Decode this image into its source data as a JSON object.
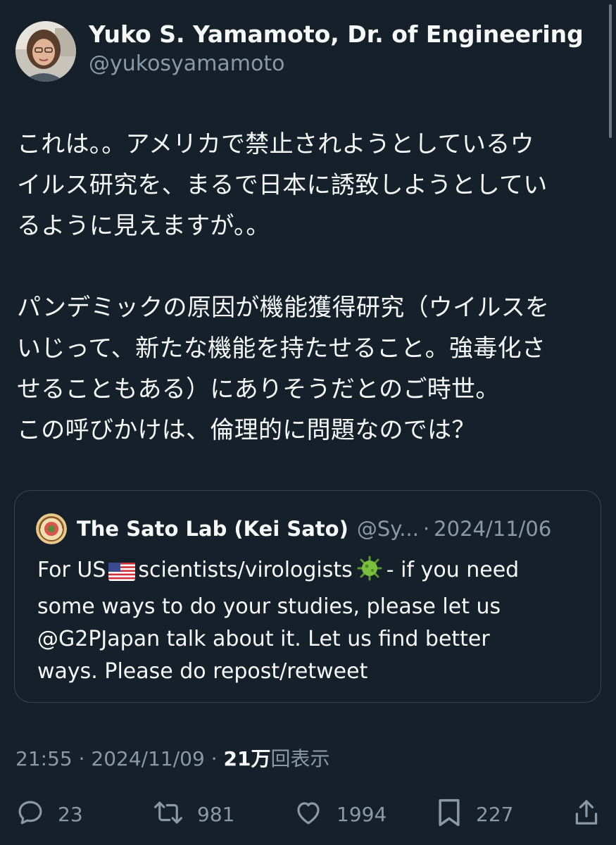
{
  "author": {
    "name": "Yuko S. Yamamoto, Dr. of Engineering",
    "handle": "@yukosyamamoto"
  },
  "tweet": {
    "paragraph1": [
      "これは。。アメリカで禁止されようとしているウ",
      "イルス研究を、まるで日本に誘致しようとしてい",
      "るように見えますが。。"
    ],
    "paragraph2": [
      "パンデミックの原因が機能獲得研究（ウイルスを",
      "いじって、新たな機能を持たせること。強毒化さ",
      "せることもある）にありそうだとのご時世。",
      "この呼びかけは、倫理的に問題なのでは？"
    ]
  },
  "quote": {
    "name": "The Sato Lab (Kei Sato)",
    "handle": "@Sy...",
    "separator": "·",
    "date": "2024/11/06",
    "line1_a": "For US",
    "line1_b": "scientists/virologists",
    "line1_c": "- if you need",
    "line2": "some ways to do your studies, please let us",
    "line3": "@G2PJapan talk about it. Let us find better",
    "line4": "ways. Please do repost/retweet"
  },
  "meta": {
    "time": "21:55",
    "separator": "·",
    "date": "2024/11/09",
    "views_count": "21万",
    "views_label": "回表示"
  },
  "actions": {
    "replies": "23",
    "reposts": "981",
    "likes": "1994",
    "bookmarks": "227"
  },
  "icons": {
    "reply": "reply-icon",
    "repost": "repost-icon",
    "like": "heart-icon",
    "bookmark": "bookmark-icon",
    "share": "share-icon"
  },
  "colors": {
    "background": "#15202b",
    "text": "#f7f9f9",
    "secondary": "#8b98a5",
    "border": "#38444d"
  }
}
